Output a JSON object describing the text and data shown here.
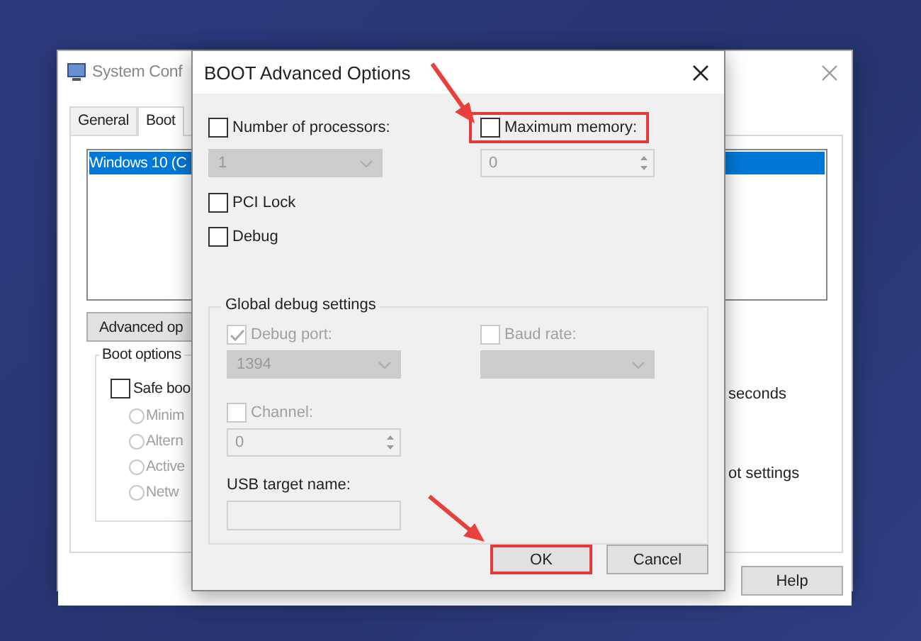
{
  "system_config": {
    "title": "System Conf",
    "tabs": [
      {
        "label": "General",
        "selected": false
      },
      {
        "label": "Boot",
        "selected": true
      }
    ],
    "boot_entries": [
      {
        "label": "Windows 10 (C",
        "selected": true
      }
    ],
    "advanced_button": "Advanced op",
    "boot_options": {
      "title": "Boot options",
      "safe_boot": {
        "label": "Safe boo",
        "checked": false
      },
      "modes": [
        {
          "label": "Minim",
          "selected": false
        },
        {
          "label": "Altern",
          "selected": false
        },
        {
          "label": "Active",
          "selected": false
        },
        {
          "label": "Netw",
          "selected": false
        }
      ]
    },
    "timeout_unit": "seconds",
    "boot_settings_text": "ot settings",
    "help_button": "Help"
  },
  "advanced_dialog": {
    "title": "BOOT Advanced Options",
    "processors": {
      "label": "Number of processors:",
      "checked": false,
      "value": "1"
    },
    "memory": {
      "label": "Maximum memory:",
      "checked": false,
      "highlighted": true,
      "value": "0"
    },
    "pci_lock": {
      "label": "PCI Lock",
      "checked": false
    },
    "debug": {
      "label": "Debug",
      "checked": false
    },
    "debug_settings": {
      "title": "Global debug settings",
      "debug_port": {
        "label": "Debug port:",
        "checked": true,
        "disabled": true,
        "value": "1394"
      },
      "baud_rate": {
        "label": "Baud rate:",
        "checked": false,
        "disabled": true
      },
      "channel": {
        "label": "Channel:",
        "checked": false,
        "disabled": true,
        "value": "0"
      },
      "usb_target": {
        "label": "USB target name:"
      }
    },
    "buttons": [
      {
        "label": "OK",
        "highlighted": true
      },
      {
        "label": "Cancel",
        "highlighted": false
      }
    ]
  }
}
